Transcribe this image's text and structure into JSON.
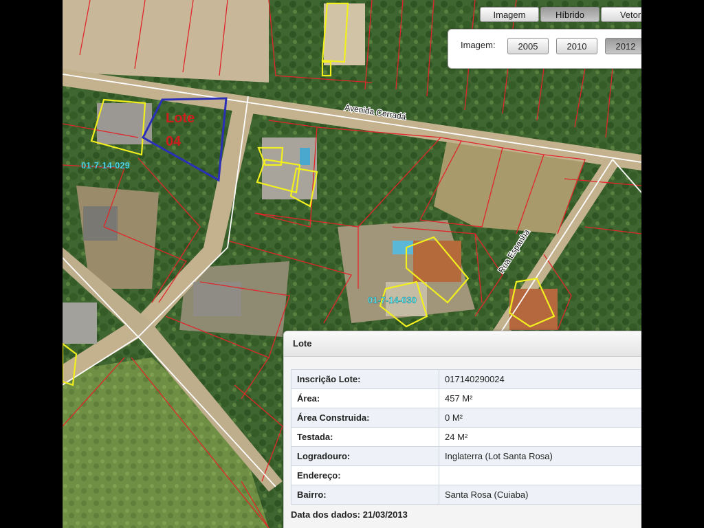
{
  "toolbar": {
    "imagem": "Imagem",
    "hibrido": "Híbrido",
    "vetor": "Vetor"
  },
  "year_panel": {
    "label": "Imagem:",
    "years": [
      "2005",
      "2010",
      "2012"
    ],
    "selected": "2012"
  },
  "map": {
    "lot_highlight_label_line1": "Lote",
    "lot_highlight_label_line2": "04",
    "parcel_labels": [
      "01-7-14-029",
      "01-7-14-030"
    ],
    "street_avenida": "Avenida Cerradá",
    "street_rua": "Rua Espanha",
    "colors": {
      "parcel_lines": "#e0262a",
      "building_outline": "#f2ef1e",
      "selected_lot": "#2b2fb8",
      "road_lines": "#ffffff"
    }
  },
  "info_panel": {
    "title": "Lote",
    "rows": [
      {
        "key": "Inscrição Lote:",
        "value": "017140290024"
      },
      {
        "key": "Área:",
        "value": "457 M²"
      },
      {
        "key": "Área Construida:",
        "value": "0 M²"
      },
      {
        "key": "Testada:",
        "value": "24 M²"
      },
      {
        "key": "Logradouro:",
        "value": "Inglaterra (Lot Santa Rosa)"
      },
      {
        "key": "Endereço:",
        "value": ""
      },
      {
        "key": "Bairro:",
        "value": "Santa Rosa (Cuiaba)"
      }
    ],
    "data_date_label": "Data dos dados:",
    "data_date_value": "21/03/2013"
  }
}
